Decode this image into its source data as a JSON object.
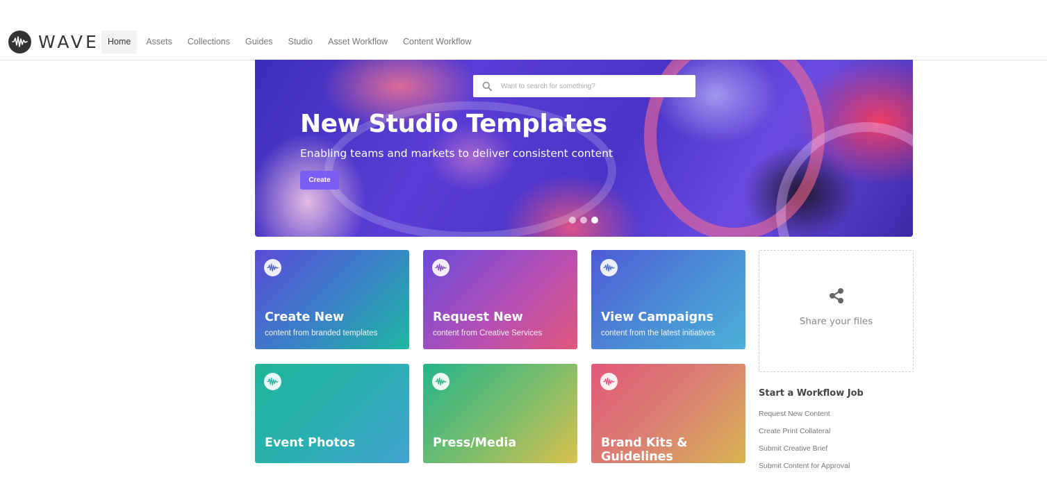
{
  "header": {
    "logo_text": "WAVE",
    "nav": [
      {
        "label": "Home",
        "active": true
      },
      {
        "label": "Assets"
      },
      {
        "label": "Collections"
      },
      {
        "label": "Guides"
      },
      {
        "label": "Studio"
      },
      {
        "label": "Asset Workflow"
      },
      {
        "label": "Content Workflow"
      }
    ]
  },
  "hero": {
    "search_placeholder": "Want to search for something?",
    "title": "New Studio Templates",
    "subtitle": "Enabling teams and markets to deliver consistent content",
    "button_label": "Create",
    "slides_count": 3,
    "active_slide": 3
  },
  "tiles": [
    {
      "title": "Create New",
      "subtitle": "content from branded templates"
    },
    {
      "title": "Request New",
      "subtitle": "content from Creative Services"
    },
    {
      "title": "View Campaigns",
      "subtitle": "content from the latest initiatives"
    },
    {
      "title": "Event Photos",
      "subtitle": ""
    },
    {
      "title": "Press/Media",
      "subtitle": ""
    },
    {
      "title": "Brand Kits & Guidelines",
      "subtitle": ""
    }
  ],
  "share": {
    "label": "Share your files",
    "icon": "share-icon"
  },
  "workflow": {
    "title": "Start a Workflow Job",
    "items": [
      "Request New Content",
      "Create Print Collateral",
      "Submit Creative Brief",
      "Submit Content for Approval"
    ]
  },
  "colors": {
    "accent": "#7b5cf5",
    "logo": "#333333"
  }
}
